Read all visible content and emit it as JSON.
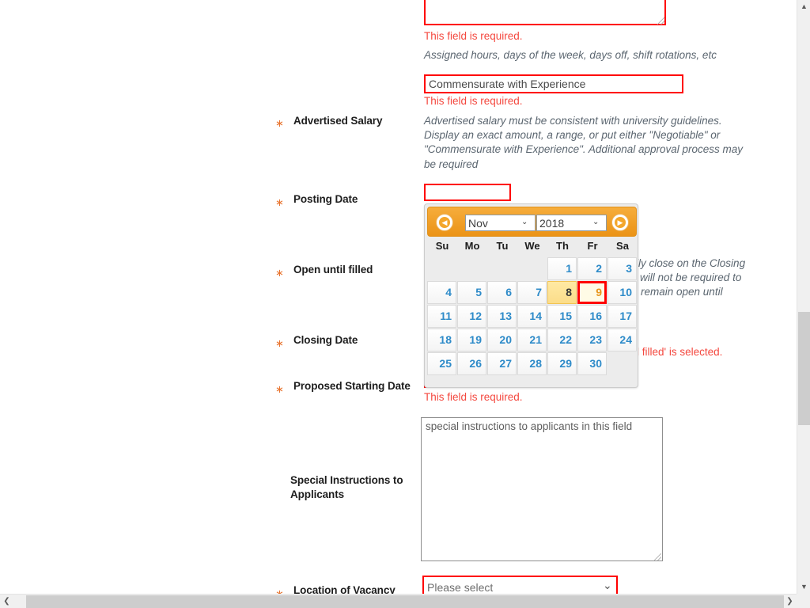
{
  "form": {
    "work_schedule": {
      "textarea_value": "",
      "error": "This field is required.",
      "help": "Assigned hours, days of the week, days off, shift rotations, etc"
    },
    "salary_input": {
      "value": "Commensurate with Experience",
      "error": "This field is required."
    },
    "advertised_salary": {
      "label": "Advertised Salary",
      "star": "∗",
      "help_line1": "Advertised salary must be consistent with university guidelines.",
      "help_line2": "Display an exact amount, a range, or put either \"Negotiable\" or",
      "help_line3": "\"Commensurate with Experience\". Additional approval process may",
      "help_line4": "be required"
    },
    "posting_date": {
      "label": "Posting Date",
      "star": "∗",
      "value": ""
    },
    "open_until_filled": {
      "label": "Open until filled",
      "star": "∗",
      "help_line1": "lly close on the Closing",
      "help_line2": "will not be required to",
      "help_line3": "remain open until"
    },
    "closing_date": {
      "label": "Closing Date",
      "star": "∗",
      "error_fragment": "l filled' is selected."
    },
    "proposed_starting_date": {
      "label": "Proposed Starting Date",
      "star": "∗",
      "error": "This field is required."
    },
    "special_instructions": {
      "label_line1": "Special Instructions to",
      "label_line2": "Applicants",
      "value": "special instructions to applicants in this field"
    },
    "location_of_vacancy": {
      "label": "Location of Vacancy",
      "star": "∗",
      "selected": "Please select",
      "chevron": "⌄"
    }
  },
  "datepicker": {
    "prev_icon": "◀",
    "next_icon": "▶",
    "month": "Nov",
    "year": "2018",
    "chevron": "⌄",
    "daynames": [
      "Su",
      "Mo",
      "Tu",
      "We",
      "Th",
      "Fr",
      "Sa"
    ],
    "weeks": [
      [
        "",
        "",
        "",
        "",
        "1",
        "2",
        "3"
      ],
      [
        "4",
        "5",
        "6",
        "7",
        "8",
        "9",
        "10"
      ],
      [
        "11",
        "12",
        "13",
        "14",
        "15",
        "16",
        "17"
      ],
      [
        "18",
        "19",
        "20",
        "21",
        "22",
        "23",
        "24"
      ],
      [
        "25",
        "26",
        "27",
        "28",
        "29",
        "30",
        ""
      ]
    ],
    "today": "8",
    "selected": "9"
  },
  "scrollbars": {
    "v_up": "▲",
    "v_down": "▼",
    "h_left": "❮",
    "h_right": "❯"
  },
  "colors": {
    "error_red": "#f4483f",
    "border_red": "#ff0000",
    "accent_orange": "#e8722c",
    "datepicker_orange": "#f4a62a",
    "date_blue": "#2e8bc9",
    "help_grey": "#5b6670"
  }
}
